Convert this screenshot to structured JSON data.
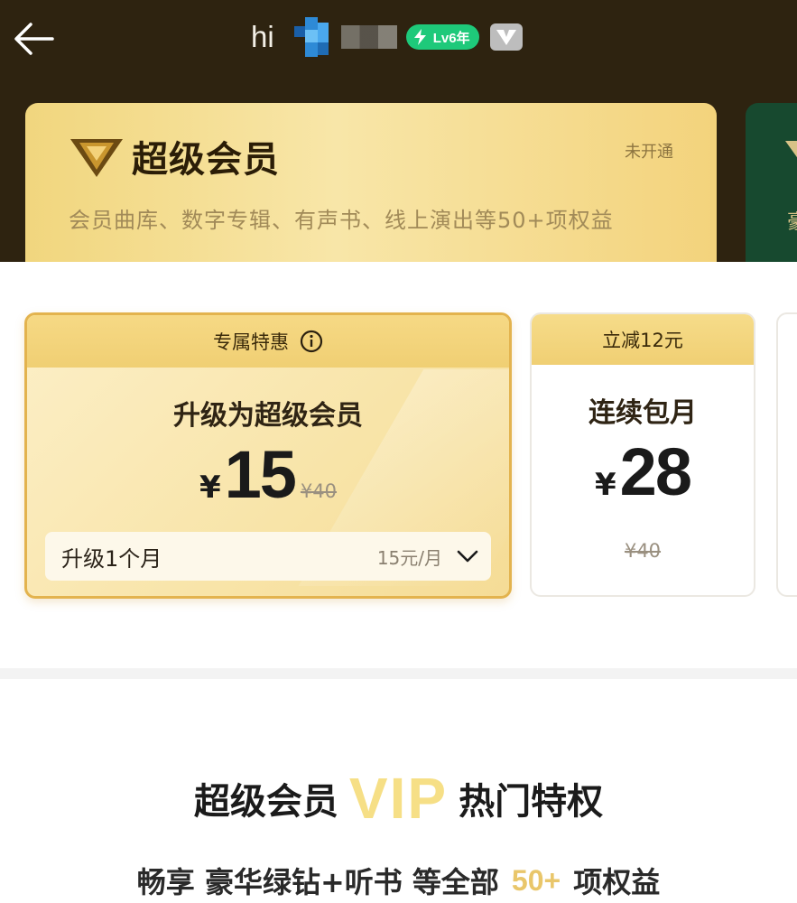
{
  "header": {
    "greeting": "hi",
    "level_badge": "Lv6年",
    "vip_badge_letter": "V"
  },
  "vip_card": {
    "title": "超级会员",
    "status": "未开通",
    "description": "会员曲库、数字专辑、有声书、线上演出等50+项权益",
    "next_card_peek_text": "豪"
  },
  "plans": [
    {
      "ribbon": "专属特惠",
      "title": "升级为超级会员",
      "currency": "¥",
      "price": "15",
      "original_price": "¥40",
      "duration_label": "升级1个月",
      "rate": "15元/月",
      "selected": true
    },
    {
      "ribbon": "立减12元",
      "title": "连续包月",
      "currency": "¥",
      "price": "28",
      "original_price": "¥40",
      "selected": false
    }
  ],
  "privileges": {
    "title_left": "超级会员",
    "title_vip": "VIP",
    "title_right": "热门特权",
    "subtitle_left": "畅享 豪华绿钻+听书 等全部",
    "subtitle_num": "50+",
    "subtitle_right": "项权益"
  },
  "colors": {
    "header_bg": "#2e2310",
    "gold": "#f1d67e",
    "green_badge": "#1ec97a",
    "vip_accent": "#f6df86"
  },
  "icons": [
    "back-arrow-icon",
    "bolt-icon",
    "crown-v-icon",
    "info-icon",
    "chevron-down-icon"
  ]
}
